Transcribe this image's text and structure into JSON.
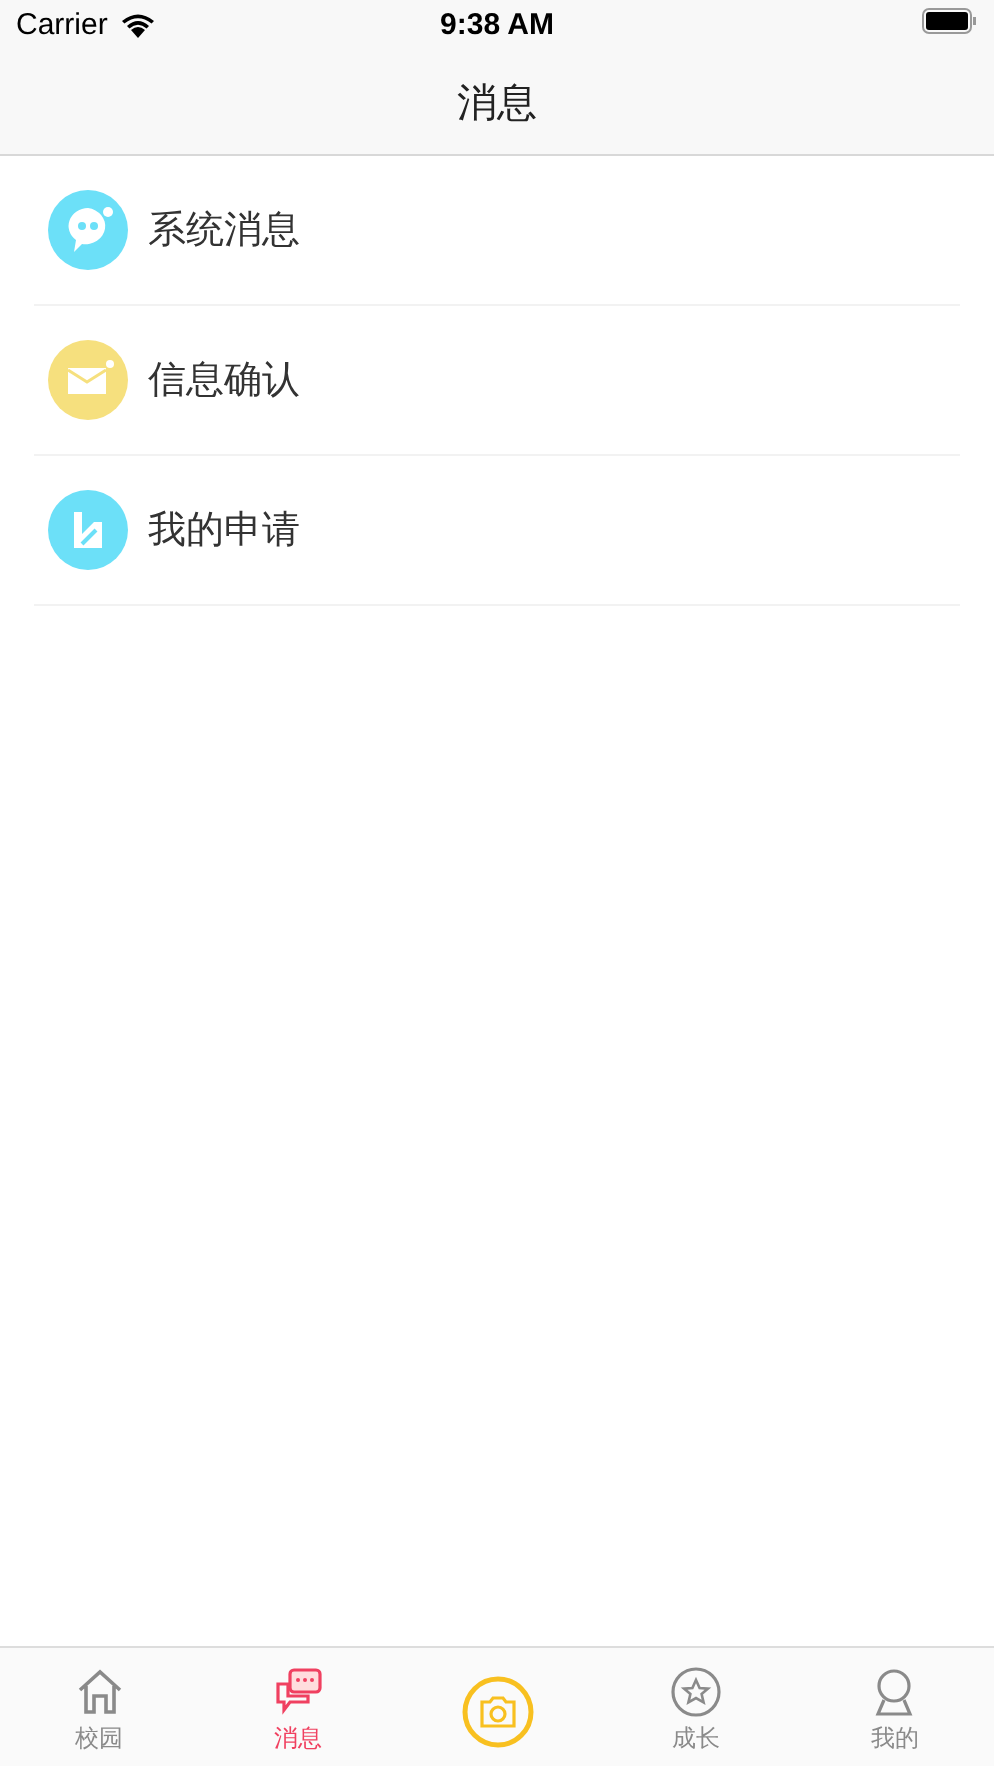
{
  "status_bar": {
    "carrier": "Carrier",
    "time": "9:38 AM"
  },
  "navigation": {
    "title": "消息"
  },
  "items": [
    {
      "kind": "chat",
      "color": "#6ce0f8",
      "label": "系统消息"
    },
    {
      "kind": "mail",
      "color": "#f6e07e",
      "label": "信息确认"
    },
    {
      "kind": "apply",
      "color": "#6ce0f8",
      "label": "我的申请"
    }
  ],
  "tabs": [
    {
      "kind": "home",
      "label": "校园",
      "selected": false
    },
    {
      "kind": "chat",
      "label": "消息",
      "selected": true
    },
    {
      "kind": "camera",
      "selected": false
    },
    {
      "kind": "star",
      "label": "成长",
      "selected": false
    },
    {
      "kind": "person",
      "label": "我的",
      "selected": false
    }
  ]
}
